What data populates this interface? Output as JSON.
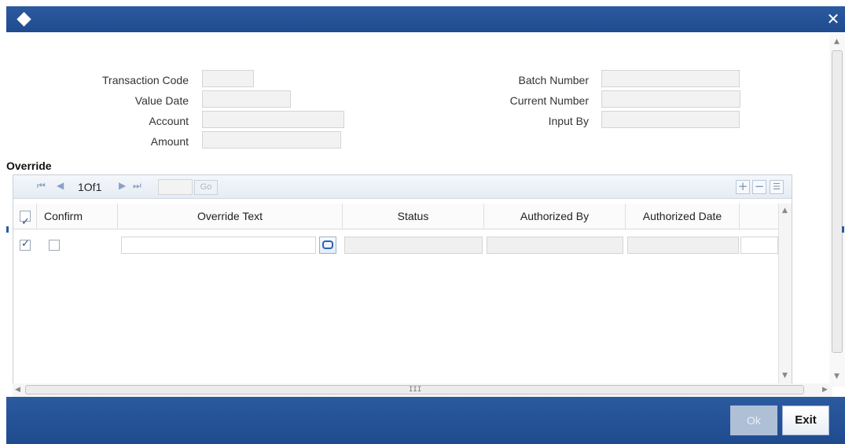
{
  "window": {
    "close_symbol": "✕"
  },
  "form": {
    "transaction_code_label": "Transaction Code",
    "value_date_label": "Value Date",
    "account_label": "Account",
    "amount_label": "Amount",
    "batch_number_label": "Batch Number",
    "current_number_label": "Current Number",
    "input_by_label": "Input By",
    "transaction_code": "",
    "value_date": "",
    "account": "",
    "amount": "",
    "batch_number": "",
    "current_number": "",
    "input_by": ""
  },
  "override": {
    "section_title": "Override",
    "pager": {
      "page_text": "1Of1",
      "go_label": "Go",
      "page_input": ""
    },
    "columns": [
      "Confirm",
      "Override Text",
      "Status",
      "Authorized By",
      "Authorized Date"
    ],
    "rows": [
      {
        "selected": true,
        "confirm": false,
        "override_text": "",
        "status": "",
        "authorized_by": "",
        "authorized_date": ""
      }
    ],
    "scroll_grip": "III"
  },
  "footer": {
    "ok_label": "Ok",
    "exit_label": "Exit"
  },
  "icons": {
    "first_page": "first-page-icon",
    "prev_page": "prev-page-icon",
    "next_page": "next-page-icon",
    "last_page": "last-page-icon",
    "add_row": "plus-icon",
    "delete_row": "minus-icon",
    "single_view": "list-view-icon",
    "lov": "lov-icon"
  },
  "colors": {
    "titlebar": "#2c5aa0",
    "footer": "#2c5aa0",
    "field_bg": "#f2f2f2"
  }
}
